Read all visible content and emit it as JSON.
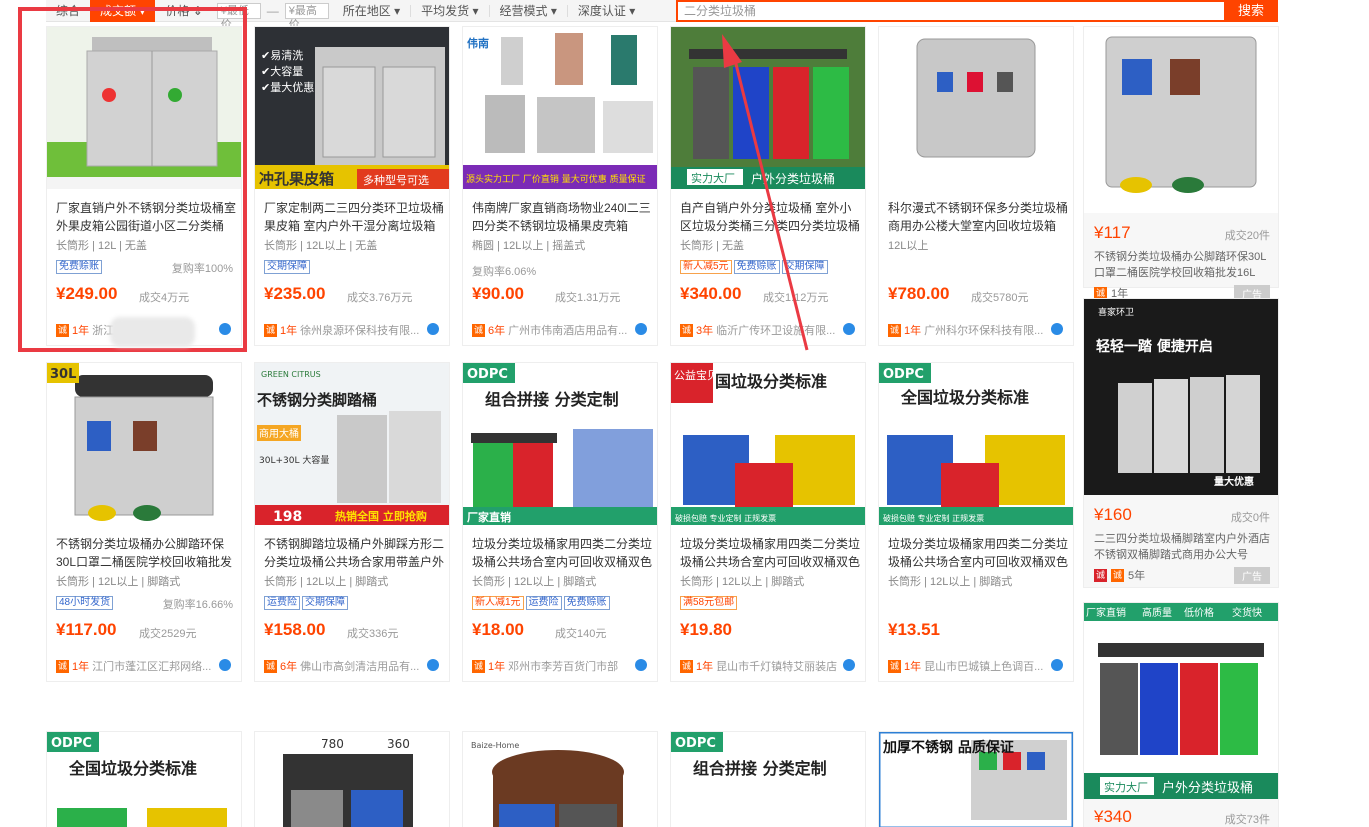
{
  "filter_bar": {
    "items": [
      "综合",
      "成交额",
      "价格"
    ],
    "price_low": "¥最低价",
    "price_high": "¥最高价",
    "dash": "—",
    "filters": [
      "所在地区",
      "平均发货",
      "经营模式",
      "深度认证"
    ],
    "search_placeholder": "二分类垃圾桶",
    "search_button": "搜索"
  },
  "products": [
    {
      "title": "厂家直销户外不锈钢分类垃圾桶室外果皮箱公园街道小区二分类桶",
      "attrs": "长筒形 | 12L | 无盖",
      "tags": [
        "免费赊账"
      ],
      "repurchase": "复购率100%",
      "price": "¥249.00",
      "sold": "成交4万元",
      "years": "1年",
      "shop": "浙江利..."
    },
    {
      "title": "厂家定制两二三四分类环卫垃圾桶果皮箱 室内户外干湿分离垃圾箱",
      "attrs": "长筒形 | 12L以上 | 无盖",
      "tags": [
        "交期保障"
      ],
      "repurchase": "",
      "price": "¥235.00",
      "sold": "成交3.76万元",
      "years": "1年",
      "shop": "徐州泉源环保科技有限..."
    },
    {
      "title": "伟南牌厂家直销商场物业240l二三四分类不锈钢垃圾桶果皮壳箱",
      "attrs": "椭圆 | 12L以上 | 摇盖式",
      "tags": [],
      "repurchase": "复购率6.06%",
      "price": "¥90.00",
      "sold": "成交1.31万元",
      "years": "6年",
      "shop": "广州市伟南酒店用品有..."
    },
    {
      "title": "自产自销户外分类垃圾桶 室外小区垃圾分类桶三分类四分类垃圾桶",
      "attrs": "长筒形 | 无盖",
      "tags": [
        "新人减5元",
        "免费赊账",
        "交期保障"
      ],
      "repurchase": "",
      "price": "¥340.00",
      "sold": "成交1.12万元",
      "years": "3年",
      "shop": "临沂广传环卫设施有限..."
    },
    {
      "title": "科尔漫式不锈钢环保多分类垃圾桶商用办公楼大堂室内回收垃圾箱",
      "attrs": "12L以上",
      "tags": [],
      "repurchase": "",
      "price": "¥780.00",
      "sold": "成交5780元",
      "years": "1年",
      "shop": "广州科尔环保科技有限..."
    },
    {
      "title": "不锈钢分类垃圾桶办公脚踏环保30L口罩二桶医院学校回收箱批发16L",
      "attrs": "长筒形 | 12L以上 | 脚踏式",
      "tags": [
        "48小时发货"
      ],
      "repurchase": "复购率16.66%",
      "price": "¥117.00",
      "sold": "成交2529元",
      "years": "1年",
      "shop": "江门市蓬江区汇邦网络..."
    },
    {
      "title": "不锈钢脚踏垃圾桶户外脚踩方形二分类垃圾桶公共场合家用带盖户外",
      "attrs": "长筒形 | 12L以上 | 脚踏式",
      "tags": [
        "运费险",
        "交期保障"
      ],
      "repurchase": "",
      "price": "¥158.00",
      "sold": "成交336元",
      "years": "6年",
      "shop": "佛山市高剑清洁用品有..."
    },
    {
      "title": "垃圾分类垃圾桶家用四类二分类垃圾桶公共场合室内可回收双桶双色",
      "attrs": "长筒形 | 12L以上 | 脚踏式",
      "tags": [
        "新人减1元",
        "运费险",
        "免费赊账"
      ],
      "repurchase": "",
      "price": "¥18.00",
      "sold": "成交140元",
      "years": "1年",
      "shop": "邓州市李芳百货门市部"
    },
    {
      "title": "垃圾分类垃圾桶家用四类二分类垃圾桶公共场合室内可回收双桶双色",
      "attrs": "长筒形 | 12L以上 | 脚踏式",
      "tags": [
        "满58元包邮"
      ],
      "repurchase": "",
      "price": "¥19.80",
      "sold": "",
      "years": "1年",
      "shop": "昆山市千灯镇特艾丽装店"
    },
    {
      "title": "垃圾分类垃圾桶家用四类二分类垃圾桶公共场合室内可回收双桶双色",
      "attrs": "长筒形 | 12L以上 | 脚踏式",
      "tags": [],
      "repurchase": "",
      "price": "¥13.51",
      "sold": "",
      "years": "1年",
      "shop": "昆山市巴城镇上色调百..."
    }
  ],
  "ads": [
    {
      "price": "¥117",
      "sold": "成交20件",
      "title": "不锈钢分类垃圾桶办公脚踏环保30L口罩二桶医院学校回收箱批发16L",
      "years": "1年",
      "label": "广告"
    },
    {
      "price": "¥160",
      "sold": "成交0件",
      "title": "二三四分类垃圾桶脚踏室内户外酒店不锈钢双桶脚踏式商用办公大号",
      "years": "5年",
      "label": "广告"
    },
    {
      "price": "¥340",
      "sold": "成交73件"
    }
  ],
  "image_texts": {
    "p2_badges": [
      "✔易清洗",
      "✔大容量",
      "✔量大优惠"
    ],
    "p2_banner": "冲孔果皮箱",
    "p2_banner2": "多种型号可选",
    "p3_brand": "伟南",
    "p3_banner": "源头实力工厂  厂价直销  量大可优惠  质量保证",
    "p4_banner": "实力大厂",
    "p4_banner2": "户外分类垃圾桶",
    "p6_label": "30L",
    "p7_brand": "GREEN CITRUS",
    "p7_title": "不锈钢分类脚踏桶",
    "p7_sub": "商用大桶",
    "p7_cap": "30L+30L 大容量",
    "p7_price": "198",
    "p7_banner": "热销全国 立即抢购",
    "odpc": "ODPC",
    "p8_title": "组合拼接 分类定制",
    "p8_banner": "厂家直销",
    "p9_title": "国垃圾分类标准",
    "p9_tag": "公益宝贝",
    "p10_title": "全国垃圾分类标准",
    "banner_common": "破损包赔 专业定制 正规发票",
    "row3_t1": "全国垃圾分类标准",
    "row3_d1": "780",
    "row3_d2": "360",
    "row3_brand": "Baize-Home",
    "row3_t4": "组合拼接 分类定制",
    "row3_t5": "加厚不锈钢 品质保证",
    "ad2_brand": "喜家环卫",
    "ad2_title": "轻轻一踏 便捷开启",
    "ad2_promo": "量大优惠",
    "ad3_tags": [
      "厂家直销",
      "高质量",
      "低价格",
      "交货快"
    ],
    "ad3_banner": "实力大厂",
    "ad3_banner2": "户外分类垃圾桶"
  }
}
